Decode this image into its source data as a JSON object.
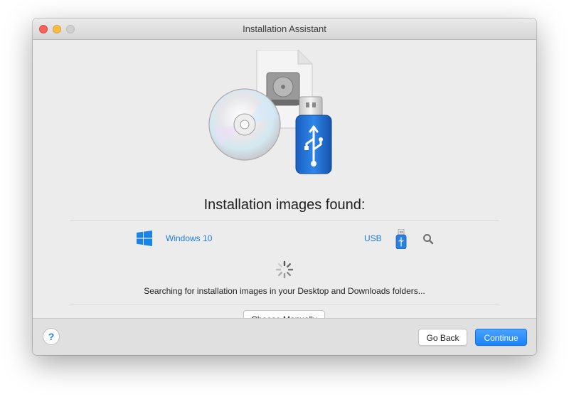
{
  "window": {
    "title": "Installation Assistant"
  },
  "main": {
    "heading": "Installation images found:",
    "found_items": [
      {
        "label": "Windows 10",
        "icon": "windows-logo-icon",
        "color": "#1f7ce0"
      },
      {
        "label": "USB",
        "icon": "usb-drive-icon",
        "color": "#1f7ce0"
      }
    ],
    "status_text": "Searching for installation images in your Desktop and Downloads folders...",
    "choose_manually_label": "Choose Manually"
  },
  "footer": {
    "help_label": "?",
    "go_back_label": "Go Back",
    "continue_label": "Continue"
  },
  "colors": {
    "accent": "#1f7ce0",
    "primary_button": "#1a83fb",
    "close": "#fc605c",
    "minimize": "#fdbc40"
  }
}
